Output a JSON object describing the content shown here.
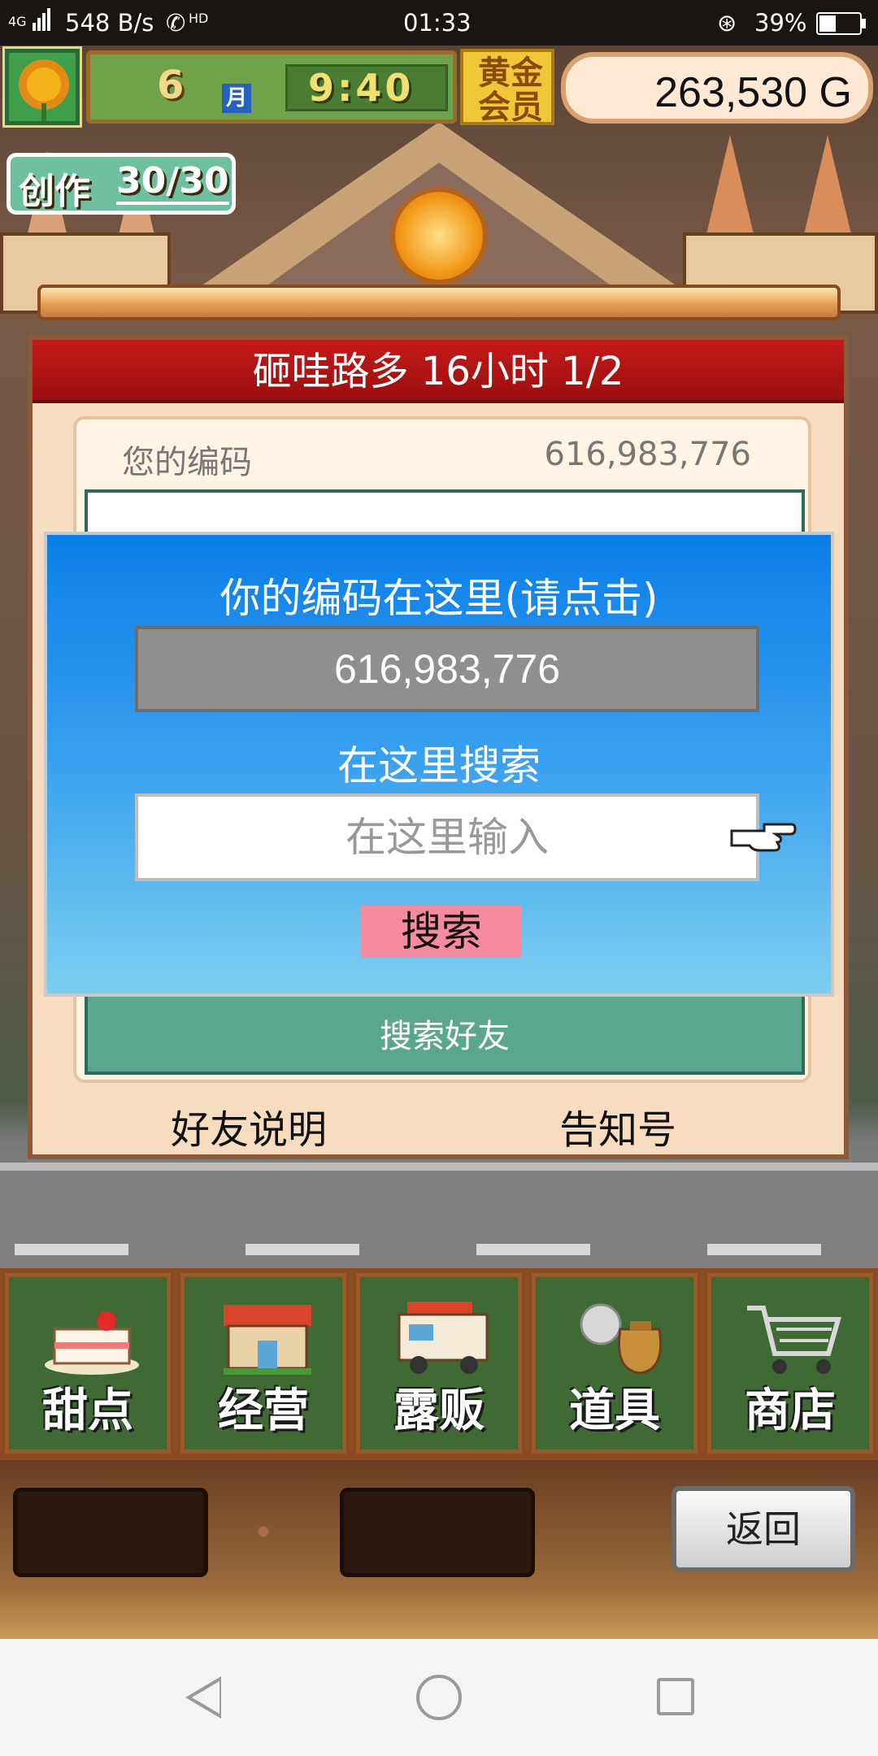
{
  "status_bar": {
    "network": "4G",
    "speed": "548 B/s",
    "hd": "HD",
    "time": "01:33",
    "battery": "39%"
  },
  "hud": {
    "month_number": "6",
    "month_label": "月",
    "clock": "9:40",
    "gold_member": [
      "黄金",
      "会员"
    ],
    "money": "263,530 G",
    "create_label": "创作",
    "create_count": "30/30"
  },
  "panel": {
    "title": "砸哇路多  16小时 1/2",
    "your_code_label": "您的编码",
    "your_code_value": "616,983,776",
    "search_friends": "搜索好友",
    "friend_help": "好友说明",
    "notice": "告知号"
  },
  "dialog": {
    "title": "你的编码在这里(请点击)",
    "code": "616,983,776",
    "search_label": "在这里搜索",
    "input_placeholder": "在这里输入",
    "search_button": "搜索"
  },
  "menu": [
    {
      "label": "甜点",
      "icon": "cake-icon"
    },
    {
      "label": "经营",
      "icon": "shop-icon"
    },
    {
      "label": "露贩",
      "icon": "food-truck-icon"
    },
    {
      "label": "道具",
      "icon": "item-bag-icon"
    },
    {
      "label": "商店",
      "icon": "shopping-cart-icon"
    }
  ],
  "back_button": "返回",
  "colors": {
    "dialog_blue": "#0a7de8",
    "panel_title_red": "#c51a1a",
    "search_button_pink": "#f58aa0",
    "menu_green": "#3f6a34"
  }
}
